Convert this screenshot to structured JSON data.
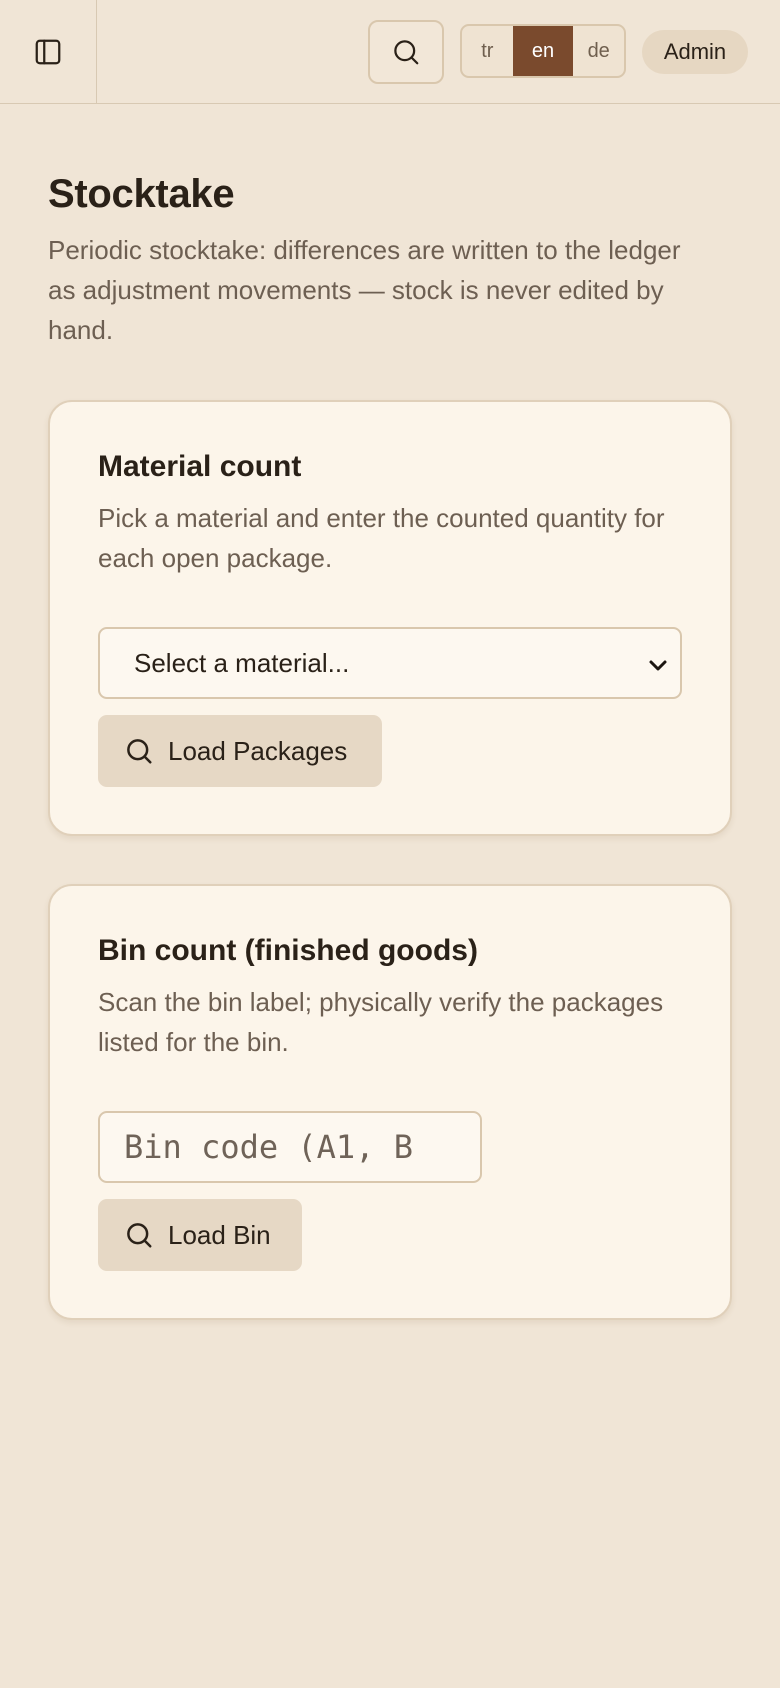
{
  "header": {
    "languages": [
      "tr",
      "en",
      "de"
    ],
    "active_language": "en",
    "user_label": "Admin"
  },
  "page": {
    "title": "Stocktake",
    "description": "Periodic stocktake: differences are written to the ledger as adjustment movements — stock is never edited by hand."
  },
  "material_count": {
    "title": "Material count",
    "description": "Pick a material and enter the counted quantity for each open package.",
    "select_value": "Select a material...",
    "button_label": "Load Packages"
  },
  "bin_count": {
    "title": "Bin count (finished goods)",
    "description": "Scan the bin label; physically verify the packages listed for the bin.",
    "input_placeholder": "Bin code (A1, B",
    "input_value": "",
    "button_label": "Load Bin"
  },
  "colors": {
    "background": "#f0e5d6",
    "card": "#fcf5ea",
    "accent": "#7a4a2d",
    "button": "#e6d8c5"
  },
  "icons": {
    "sidebar_toggle": "sidebar-panel-icon",
    "search": "search-icon",
    "select": "chevron-down-icon"
  }
}
